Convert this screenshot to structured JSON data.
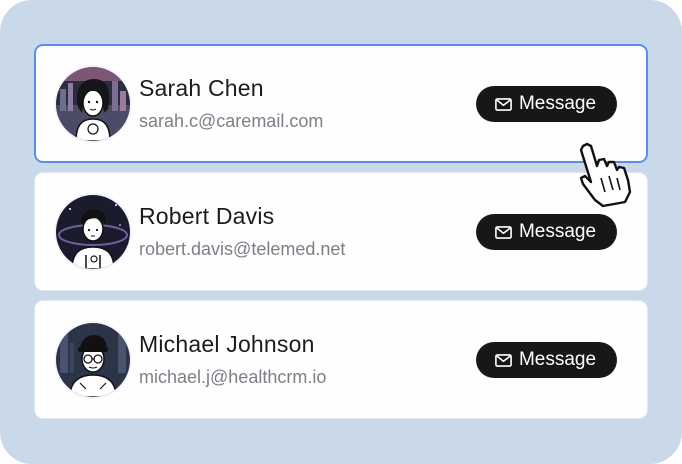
{
  "contacts": [
    {
      "name": "Sarah Chen",
      "email": "sarah.c@caremail.com",
      "button_label": "Message",
      "avatar_icon": "avatar-woman-illustration",
      "active": true
    },
    {
      "name": "Robert Davis",
      "email": "robert.davis@telemed.net",
      "button_label": "Message",
      "avatar_icon": "avatar-man-illustration",
      "active": false
    },
    {
      "name": "Michael Johnson",
      "email": "michael.j@healthcrm.io",
      "button_label": "Message",
      "avatar_icon": "avatar-man-glasses-illustration",
      "active": false
    }
  ],
  "colors": {
    "background": "#c9d9e9",
    "card": "#fefeff",
    "active_border": "#5b8ee6",
    "button": "#17171a",
    "name_text": "#1c1c1e",
    "email_text": "#7c7f86"
  },
  "cursor_icon": "hand-pointer-cursor"
}
